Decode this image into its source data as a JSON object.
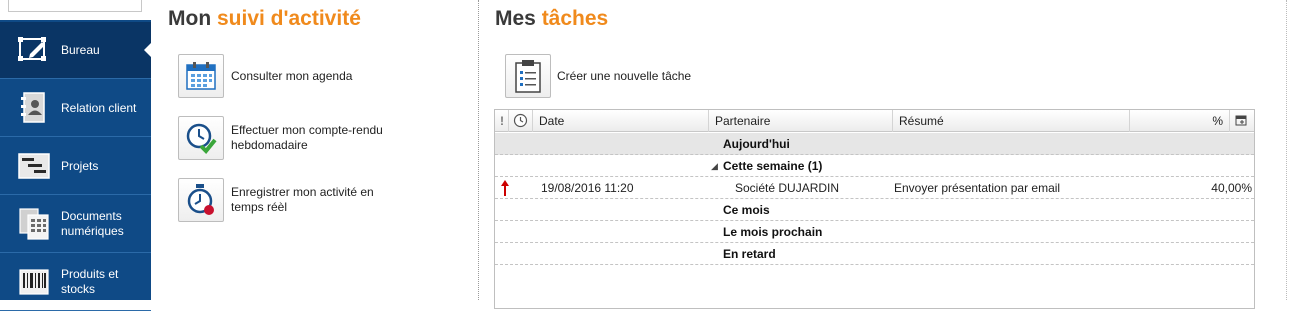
{
  "sidebar": {
    "items": [
      {
        "label": "Bureau",
        "icon": "desk-edit-icon",
        "active": true
      },
      {
        "label": "Relation client",
        "icon": "address-book-icon",
        "active": false
      },
      {
        "label": "Projets",
        "icon": "gantt-chart-icon",
        "active": false
      },
      {
        "label": "Documents numériques",
        "icon": "scanned-document-icon",
        "active": false
      },
      {
        "label": "Produits et stocks",
        "icon": "barcode-icon",
        "active": false
      }
    ]
  },
  "activity": {
    "title_part1": "Mon ",
    "title_part2": "suivi d'activité",
    "actions": [
      {
        "label": "Consulter mon agenda",
        "icon": "calendar-icon"
      },
      {
        "label": "Effectuer mon compte-rendu hebdomadaire",
        "icon": "clock-check-icon"
      },
      {
        "label": "Enregistrer mon activité en temps réèl",
        "icon": "stopwatch-record-icon"
      }
    ]
  },
  "tasks": {
    "title_part1": "Mes ",
    "title_part2": "tâches",
    "new_task_label": "Créer une nouvelle tâche",
    "columns": {
      "priority": "!",
      "date": "Date",
      "partner": "Partenaire",
      "summary": "Résumé",
      "percent": "%"
    },
    "groups": [
      {
        "label": "Aujourd'hui"
      },
      {
        "label": "Cette semaine (1)",
        "expanded": true
      },
      {
        "label": "Ce mois"
      },
      {
        "label": "Le mois prochain"
      },
      {
        "label": "En retard"
      }
    ],
    "rows": [
      {
        "priority": "high",
        "date": "19/08/2016 11:20",
        "partner": "Société DUJARDIN",
        "summary": "Envoyer présentation par email",
        "percent": "40,00%"
      }
    ]
  },
  "colors": {
    "sidebar_bg": "#0f4a86",
    "sidebar_active": "#0a3565",
    "accent": "#f08a1c",
    "priority_high": "#cc0000"
  }
}
